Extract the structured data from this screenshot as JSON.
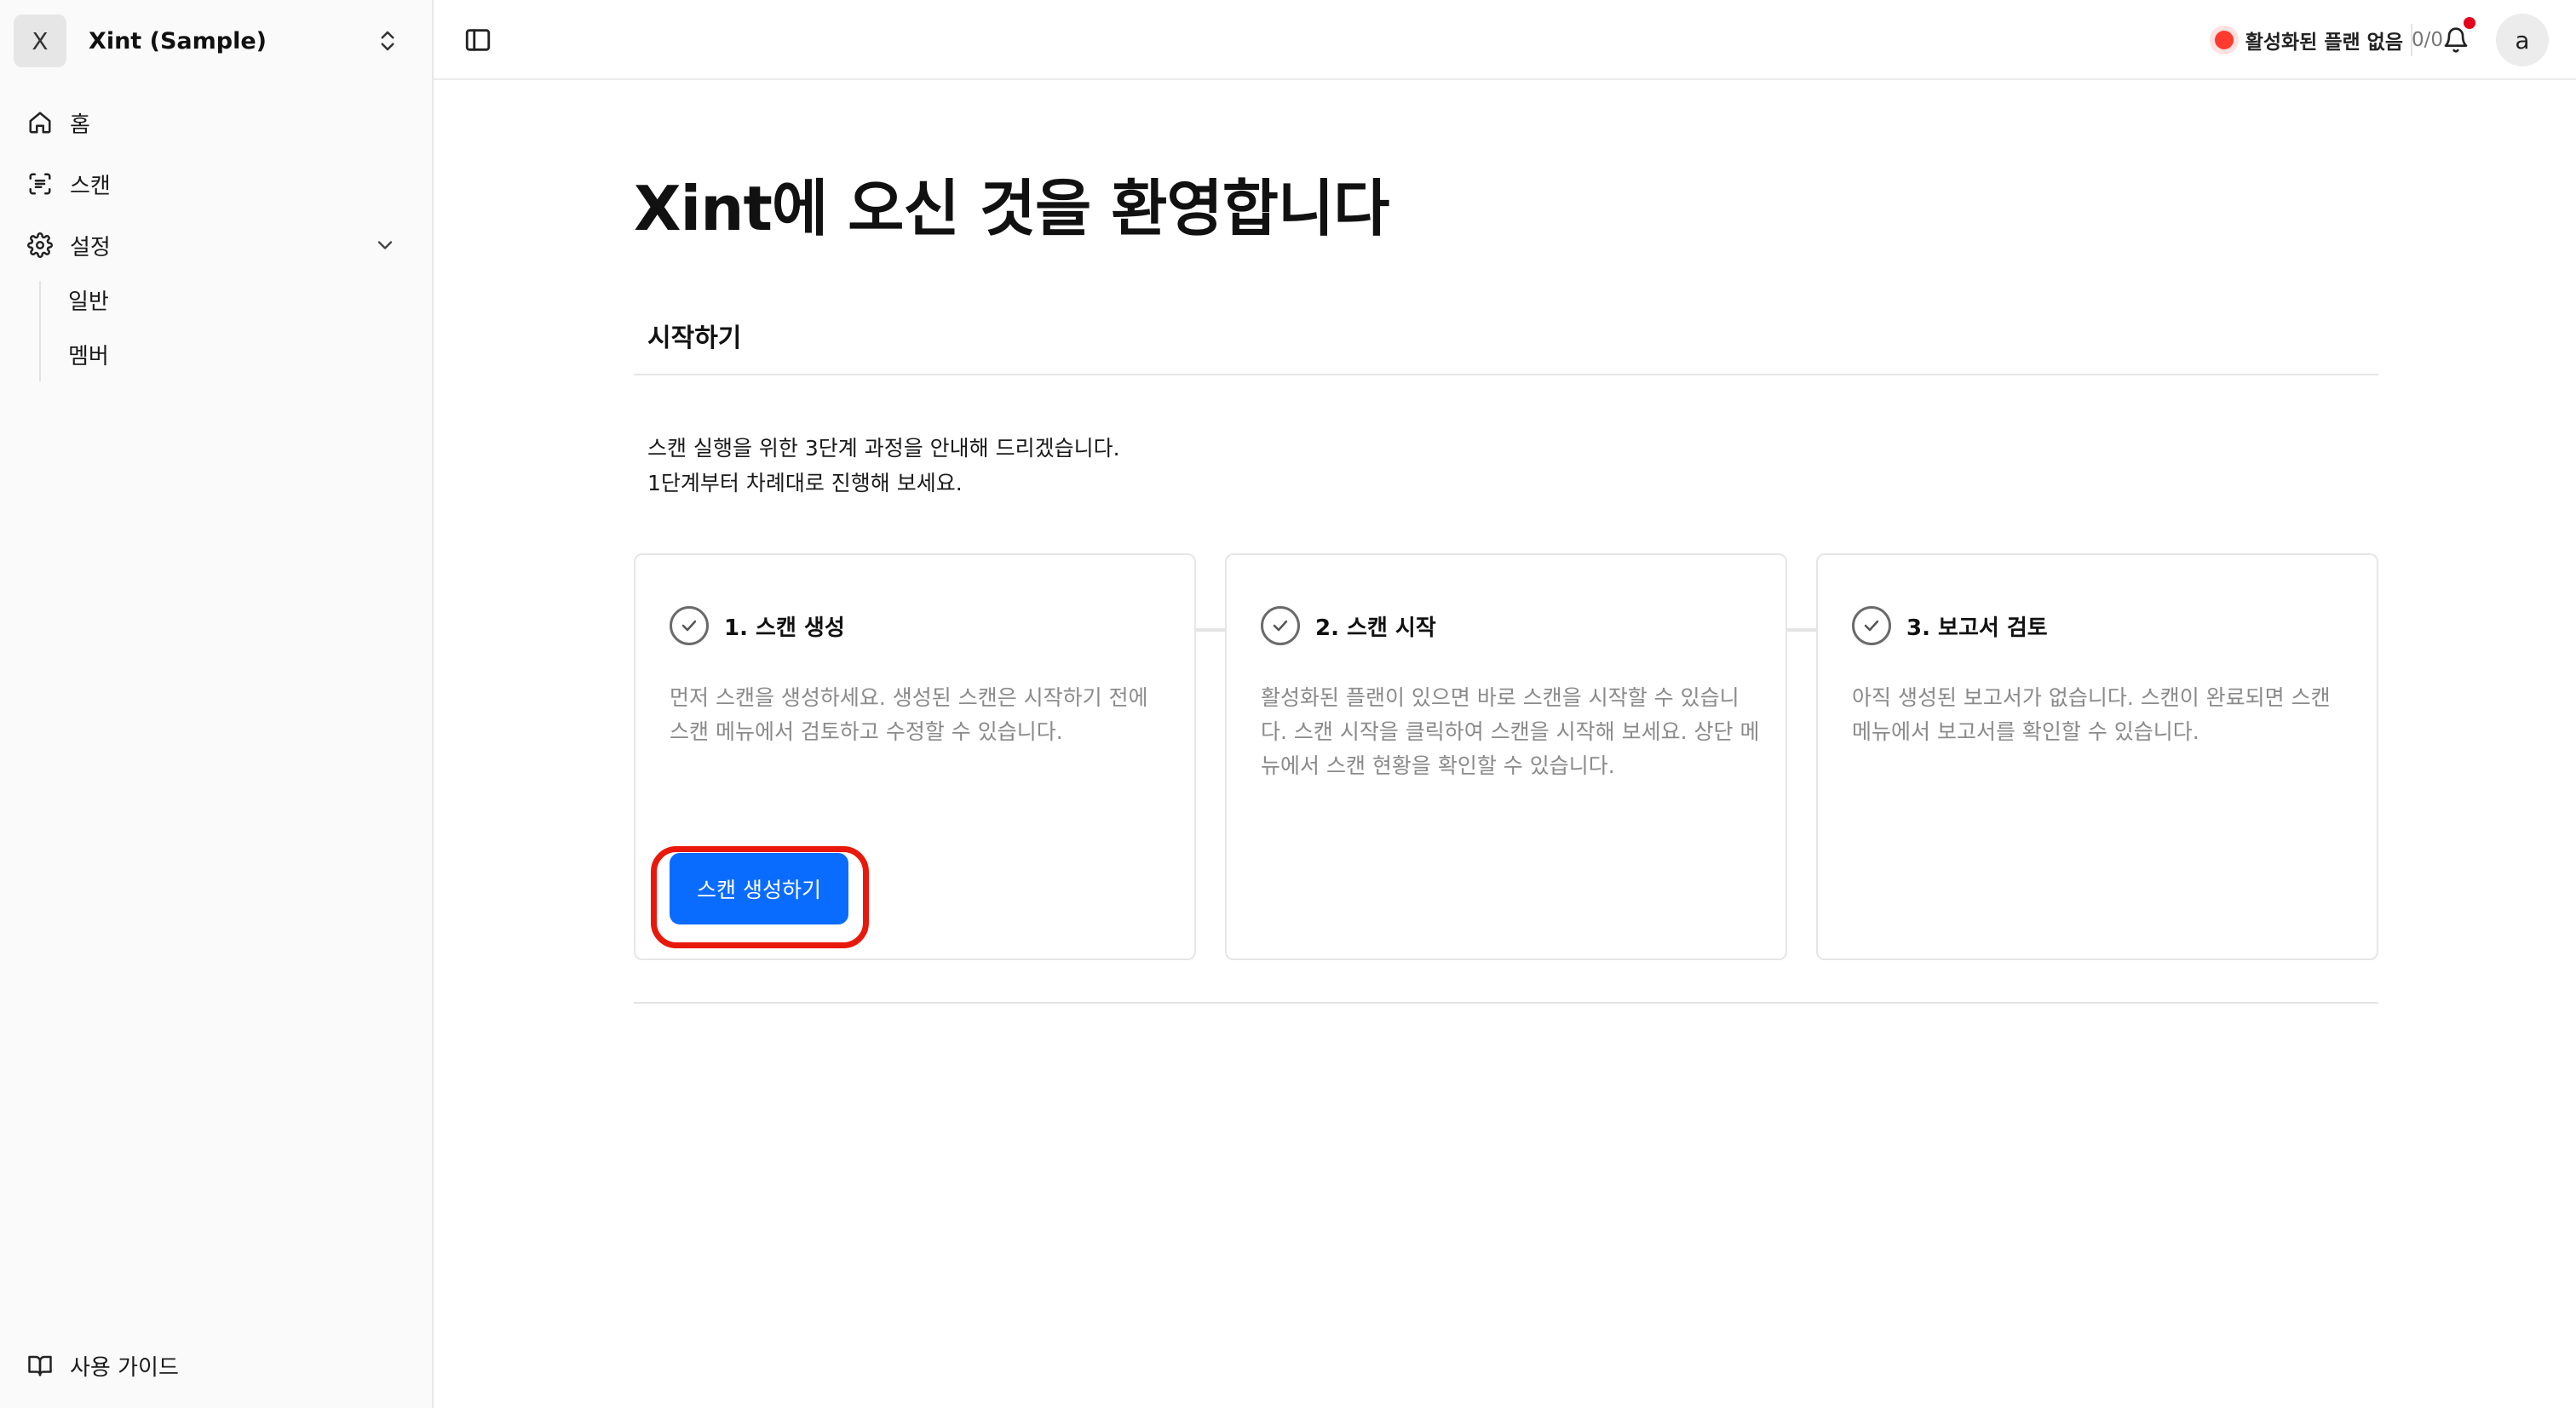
{
  "workspace": {
    "initial": "X",
    "name": "Xint (Sample)"
  },
  "nav": {
    "home": "홈",
    "scan": "스캔",
    "settings": "설정",
    "settings_children": [
      "일반",
      "멤버"
    ],
    "guide": "사용 가이드"
  },
  "topbar": {
    "plan_label": "활성화된 플랜 없음",
    "plan_count": "0/0",
    "user_initial": "a"
  },
  "main": {
    "title": "Xint에 오신 것을 환영합니다",
    "section": "시작하기",
    "intro_line1": "스캔 실행을 위한 3단계 과정을 안내해 드리겠습니다.",
    "intro_line2": "1단계부터 차례대로 진행해 보세요.",
    "steps": [
      {
        "title": "1. 스캔 생성",
        "description": "먼저 스캔을 생성하세요. 생성된 스캔은 시작하기 전에 스캔 메뉴에서 검토하고 수정할 수 있습니다.",
        "button": "스캔 생성하기"
      },
      {
        "title": "2. 스캔 시작",
        "description": "활성화된 플랜이 있으면 바로 스캔을 시작할 수 있습니다. 스캔 시작을 클릭하여 스캔을 시작해 보세요. 상단 메뉴에서 스캔 현황을 확인할 수 있습니다."
      },
      {
        "title": "3. 보고서 검토",
        "description": "아직 생성된 보고서가 없습니다. 스캔이 완료되면 스캔 메뉴에서 보고서를 확인할 수 있습니다."
      }
    ]
  },
  "colors": {
    "primary": "#0a6cff",
    "highlight_ring": "#e8190b",
    "status_dot": "#ff3b30",
    "notification_dot": "#e3001b"
  }
}
